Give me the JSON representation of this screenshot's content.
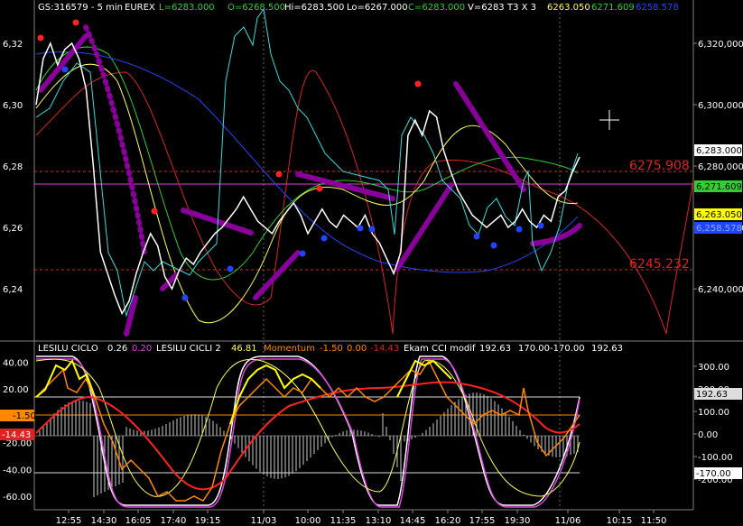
{
  "header": {
    "symbol": "GS:316579 - 5 min",
    "exchange": "EUREX",
    "last": "L=6283.000",
    "open": "O=6268.500",
    "high": "Hi=6283.500",
    "low": "Lo=6267.000",
    "close": "C=6283.000",
    "volume": "V=6283",
    "t3": "T3 X 3",
    "ma1": "6263.050",
    "ma2": "6271.609",
    "ma3": "6258.578"
  },
  "lower_header": {
    "lesilu_ciclo": "LESILU CICLO",
    "lesilu_v1": "0.26",
    "lesilu_v2": "0.20",
    "lesilu2": "LESILU CICLI 2",
    "lesilu2_v": "46.81",
    "momentum": "Momentum",
    "mom_v1": "-1.50",
    "mom_v2": "0.00",
    "mom_v3": "-14.43",
    "cci": "Ekam CCI modif",
    "cci_v1": "192.63",
    "cci_v2": "170.00",
    "cci_v3": "-170.00",
    "cci_v4": "192.63"
  },
  "price_levels": {
    "upper": "6275.908",
    "lower": "6245.232"
  },
  "right_tags": {
    "last": "6,283.000",
    "green": "6,271.609",
    "yellow": "6,263.050",
    "blue": "6,258.578",
    "cci_up": "192.63",
    "cci_down": "-170.00"
  },
  "left_tags": {
    "mom": "-1.50",
    "mom2": "-14.43"
  },
  "colors": {
    "price": "#ffffff",
    "cyan": "#33dddd",
    "red": "#dd2222",
    "yellow": "#ffff55",
    "green": "#33cc33",
    "blue": "#2244ff",
    "purple": "#880099",
    "orange": "#ff8800",
    "magenta": "#dd44dd"
  },
  "chart_data": [
    {
      "type": "line",
      "title": "",
      "yticks_left": [
        "6,32",
        "6,30",
        "6,28",
        "6,26",
        "6,24"
      ],
      "yticks_right": [
        "6,320,000",
        "6,300,000",
        "6,280,000",
        "6,260,000",
        "6,240,000"
      ],
      "ylim": [
        6223,
        6330
      ],
      "series": [
        {
          "values": [
            6300,
            6315,
            6320,
            6313,
            6318,
            6320,
            6315,
            6305,
            6280,
            6252,
            6245,
            6238,
            6232,
            6236,
            6245,
            6252,
            6258,
            6254,
            6244,
            6240,
            6246,
            6250,
            6248,
            6252,
            6255,
            6258,
            6260,
            6263,
            6266,
            6270,
            6266,
            6262,
            6260,
            6258,
            6262,
            6265,
            6268,
            6264,
            6258,
            6262,
            6266,
            6262,
            6260,
            6264,
            6262,
            6260,
            6264,
            6258,
            6255,
            6250,
            6245,
            6252,
            6290,
            6295,
            6290,
            6298,
            6296,
            6285,
            6278,
            6272,
            6268,
            6264,
            6262,
            6260,
            6262,
            6264,
            6260,
            6262,
            6266,
            6262,
            6260,
            6264,
            6262,
            6270,
            6272,
            6278,
            6283
          ]
        }
      ]
    },
    {
      "type": "line",
      "title": "",
      "yticks_left": [
        "40.00",
        "20.00",
        "0.00",
        "-20.00",
        "-40.00",
        "-60.00"
      ],
      "yticks_right": [
        "300.00",
        "200.00",
        "100.00",
        "0.00",
        "-100.00",
        "-200.00"
      ],
      "ylim": [
        -70,
        45
      ],
      "series": [
        {
          "values": [
            42,
            42,
            40,
            35,
            25,
            0,
            -40,
            -60,
            -65,
            -60,
            -50,
            -40,
            -20,
            10,
            40,
            42,
            42,
            40,
            38,
            35,
            30,
            20,
            0,
            -30,
            -55,
            -62,
            -60,
            -50,
            -30,
            0,
            20,
            35,
            42,
            40,
            30,
            10,
            -20,
            -40,
            -55,
            -62,
            -65,
            -60,
            -50,
            -30,
            -10,
            10
          ]
        }
      ]
    }
  ],
  "xticks": [
    "12:55",
    "14:30",
    "16:05",
    "17:40",
    "19:15",
    "11/03",
    "10:00",
    "11:35",
    "13:10",
    "14:45",
    "16:20",
    "17:55",
    "19:30",
    "11/06",
    "10:15",
    "11:50"
  ]
}
